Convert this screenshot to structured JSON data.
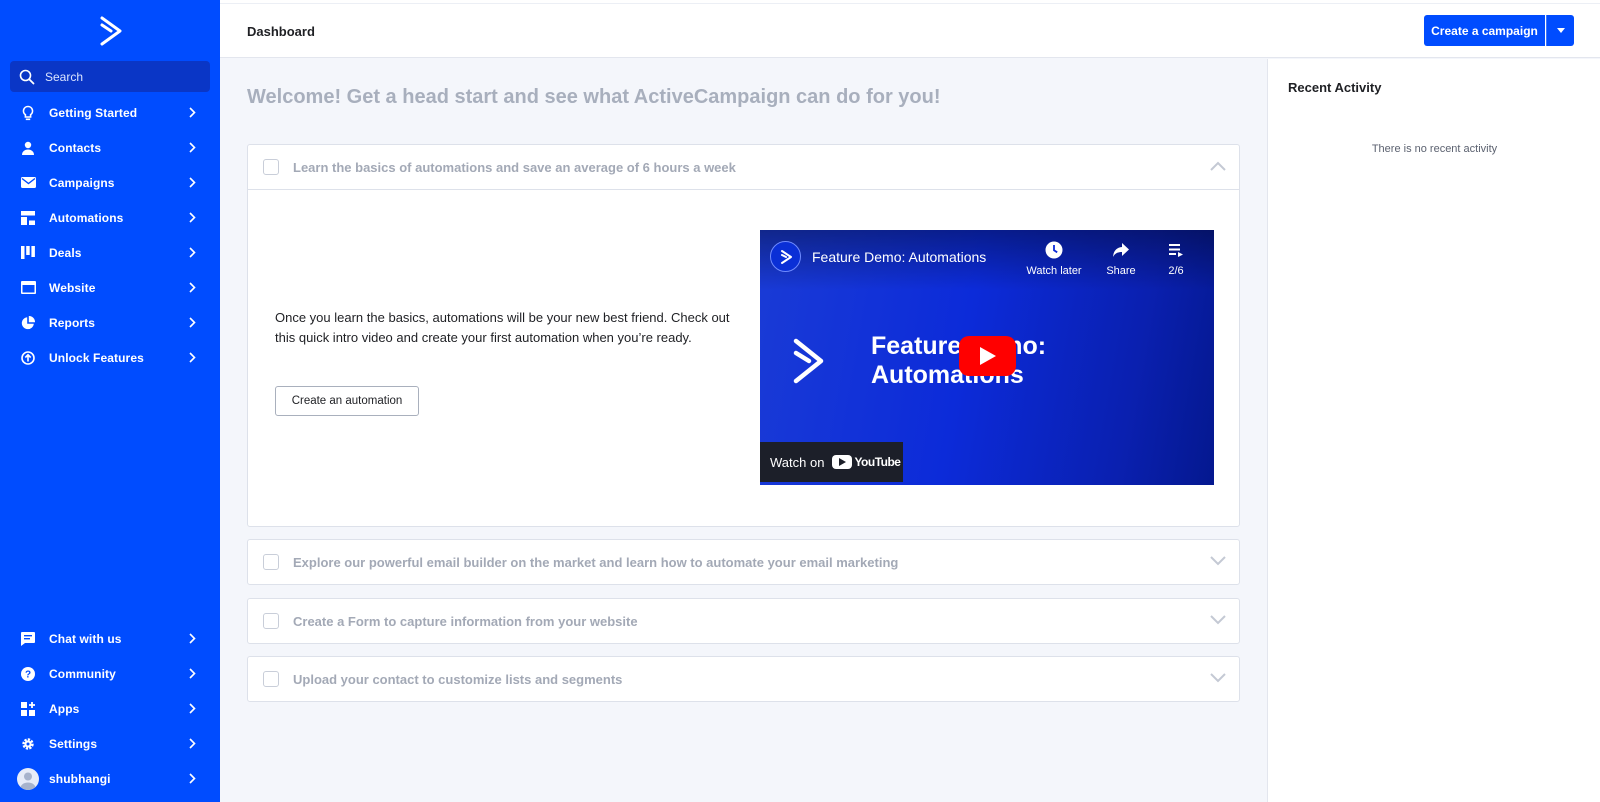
{
  "header": {
    "title": "Dashboard",
    "create_campaign_label": "Create a campaign"
  },
  "search": {
    "placeholder": "Search"
  },
  "sidebar": {
    "items": [
      {
        "label": "Getting Started",
        "icon": "lightbulb-icon"
      },
      {
        "label": "Contacts",
        "icon": "person-icon"
      },
      {
        "label": "Campaigns",
        "icon": "envelope-icon"
      },
      {
        "label": "Automations",
        "icon": "automation-icon"
      },
      {
        "label": "Deals",
        "icon": "deals-board-icon"
      },
      {
        "label": "Website",
        "icon": "browser-window-icon"
      },
      {
        "label": "Reports",
        "icon": "pie-chart-icon"
      },
      {
        "label": "Unlock Features",
        "icon": "upgrade-arrow-icon"
      }
    ],
    "bottom_items": [
      {
        "label": "Chat with us",
        "icon": "chat-icon"
      },
      {
        "label": "Community",
        "icon": "help-circle-icon"
      },
      {
        "label": "Apps",
        "icon": "apps-grid-icon"
      },
      {
        "label": "Settings",
        "icon": "gear-icon"
      },
      {
        "label": "shubhangi",
        "icon": "avatar-icon"
      }
    ]
  },
  "main": {
    "welcome": "Welcome! Get a head start and see what ActiveCampaign can do for you!",
    "cards": [
      {
        "title": "Learn the basics of automations and save an average of 6 hours a week",
        "expanded": true,
        "body": "Once you learn the basics, automations will be your new best friend. Check out this quick intro video and create your first automation when you’re ready.",
        "button_label": "Create an automation"
      },
      {
        "title": "Explore our powerful email builder on the market and learn how to automate your email marketing",
        "expanded": false
      },
      {
        "title": "Create a Form to capture information from your website",
        "expanded": false
      },
      {
        "title": "Upload your contact to customize lists and segments",
        "expanded": false
      }
    ]
  },
  "video": {
    "title": "Feature Demo: Automations",
    "watch_later": "Watch later",
    "share": "Share",
    "playlist": "2/6",
    "big_line1": "Feature Demo:",
    "big_line2": "Automations",
    "watch_on": "Watch on",
    "youtube": "YouTube"
  },
  "recent_activity": {
    "title": "Recent Activity",
    "empty_text": "There is no recent activity"
  },
  "colors": {
    "brand": "#004cff",
    "sidebar_search": "#0a36c6",
    "youtube_red": "#ff0000"
  }
}
